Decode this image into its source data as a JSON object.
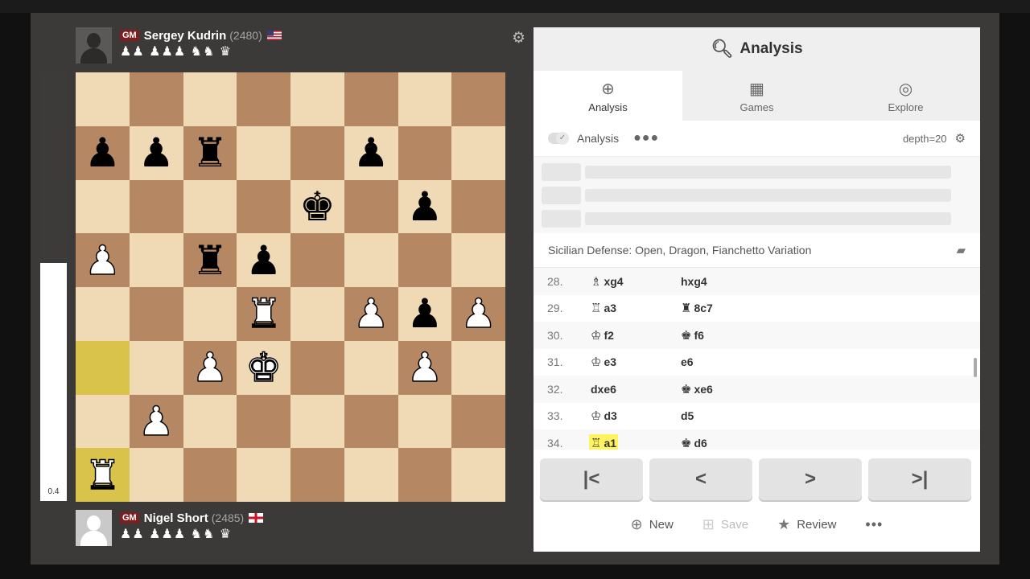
{
  "top_player": {
    "title": "GM",
    "name": "Sergey Kudrin",
    "rating": "(2480)",
    "flag": "US",
    "captured": "♟♟ ♟♟♟ ♞♞ ♛"
  },
  "bottom_player": {
    "title": "GM",
    "name": "Nigel Short",
    "rating": "(2485)",
    "flag": "England",
    "captured": "♟♟ ♟♟♟ ♞♞ ♛"
  },
  "eval": {
    "value": "0.4",
    "white_fraction": 0.555
  },
  "board": {
    "squares": [
      [
        "",
        "",
        "",
        "",
        "",
        "",
        "",
        ""
      ],
      [
        "bp",
        "bp",
        "br",
        "",
        "",
        "bp",
        "",
        ""
      ],
      [
        "",
        "",
        "",
        "",
        "bk",
        "",
        "bp",
        ""
      ],
      [
        "wp",
        "",
        "br",
        "bp",
        "",
        "",
        "",
        ""
      ],
      [
        "",
        "",
        "",
        "wr",
        "",
        "wp",
        "bp",
        "wp"
      ],
      [
        "",
        "",
        "wp",
        "wk",
        "",
        "",
        "wp",
        ""
      ],
      [
        "",
        "wp",
        "",
        "",
        "",
        "",
        "",
        ""
      ],
      [
        "wr",
        "",
        "",
        "",
        "",
        "",
        "",
        ""
      ]
    ],
    "highlights": [
      "a3",
      "a1"
    ]
  },
  "panel": {
    "title": "Analysis",
    "tabs": [
      {
        "label": "Analysis",
        "icon": "analysis-icon"
      },
      {
        "label": "Games",
        "icon": "games-icon"
      },
      {
        "label": "Explore",
        "icon": "compass-icon"
      }
    ],
    "analysis_toggle": "Analysis",
    "depth": "depth=20",
    "opening": "Sicilian Defense: Open, Dragon, Fianchetto Variation",
    "moves": [
      {
        "num": "28.",
        "white_fig": "♗",
        "white": "xg4",
        "black_fig": "",
        "black": "hxg4"
      },
      {
        "num": "29.",
        "white_fig": "♖",
        "white": "a3",
        "black_fig": "♜",
        "black": "8c7"
      },
      {
        "num": "30.",
        "white_fig": "♔",
        "white": "f2",
        "black_fig": "♚",
        "black": "f6"
      },
      {
        "num": "31.",
        "white_fig": "♔",
        "white": "e3",
        "black_fig": "",
        "black": "e6"
      },
      {
        "num": "32.",
        "white_fig": "",
        "white": "dxe6",
        "black_fig": "♚",
        "black": "xe6"
      },
      {
        "num": "33.",
        "white_fig": "♔",
        "white": "d3",
        "black_fig": "",
        "black": "d5"
      },
      {
        "num": "34.",
        "white_fig": "♖",
        "white": "a1",
        "black_fig": "♚",
        "black": "d6"
      }
    ],
    "current_move_index": 6,
    "actions": {
      "new": "New",
      "save": "Save",
      "review": "Review"
    }
  }
}
